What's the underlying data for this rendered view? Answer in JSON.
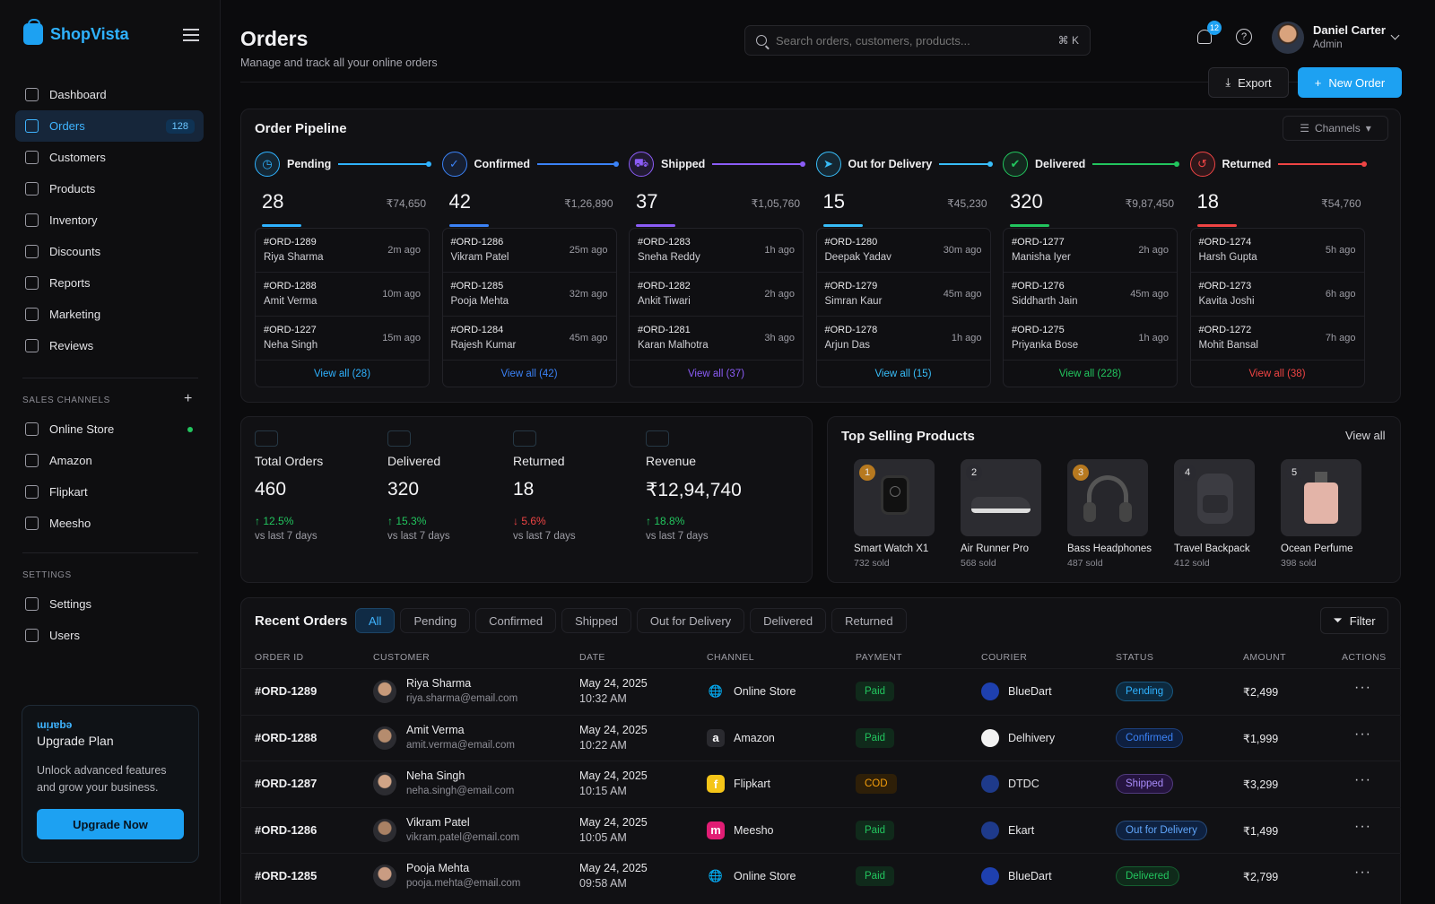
{
  "app": {
    "name": "ShopVista"
  },
  "sidebar": {
    "nav": [
      {
        "label": "Dashboard",
        "icon": "grid-icon"
      },
      {
        "label": "Orders",
        "icon": "cart-icon",
        "badge": "128",
        "active": true
      },
      {
        "label": "Customers",
        "icon": "users-icon"
      },
      {
        "label": "Products",
        "icon": "box-icon"
      },
      {
        "label": "Inventory",
        "icon": "warehouse-icon"
      },
      {
        "label": "Discounts",
        "icon": "tag-icon"
      },
      {
        "label": "Reports",
        "icon": "bar-chart-icon"
      },
      {
        "label": "Marketing",
        "icon": "megaphone-icon"
      },
      {
        "label": "Reviews",
        "icon": "star-box-icon"
      }
    ],
    "sales_channels_title": "SALES CHANNELS",
    "channels": [
      {
        "label": "Online Store",
        "icon": "globe-icon",
        "online": true
      },
      {
        "label": "Amazon",
        "icon": "amazon-icon"
      },
      {
        "label": "Flipkart",
        "icon": "flipkart-icon"
      },
      {
        "label": "Meesho",
        "icon": "meesho-icon"
      }
    ],
    "settings_title": "SETTINGS",
    "settings": [
      {
        "label": "Settings",
        "icon": "gear-icon"
      },
      {
        "label": "Users",
        "icon": "users-icon"
      }
    ],
    "upgrade": {
      "tagline": "ɯᴉɹɐbǝ",
      "title": "Upgrade Plan",
      "desc": "Unlock advanced features and grow your business.",
      "button": "Upgrade Now"
    }
  },
  "header": {
    "title": "Orders",
    "subtitle": "Manage and track all your online orders",
    "search_placeholder": "Search orders, customers, products...",
    "search_shortcut": "⌘ K",
    "notifications": "12",
    "user_name": "Daniel Carter",
    "user_role": "Admin",
    "export_label": "Export",
    "new_order_label": "New Order"
  },
  "pipeline": {
    "title": "Order Pipeline",
    "channels_label": "Channels",
    "stages": [
      {
        "name": "Pending",
        "count": "28",
        "amount": "₹74,650",
        "color": "#2fb2ff",
        "icon": "clock-icon",
        "items": [
          {
            "id": "#ORD-1289",
            "customer": "Riya Sharma",
            "time": "2m ago"
          },
          {
            "id": "#ORD-1288",
            "customer": "Amit Verma",
            "time": "10m ago"
          },
          {
            "id": "#ORD-1227",
            "customer": "Neha Singh",
            "time": "15m ago"
          }
        ],
        "view_all": "View all (28)"
      },
      {
        "name": "Confirmed",
        "count": "42",
        "amount": "₹1,26,890",
        "color": "#3b82f6",
        "icon": "check-icon",
        "items": [
          {
            "id": "#ORD-1286",
            "customer": "Vikram Patel",
            "time": "25m ago"
          },
          {
            "id": "#ORD-1285",
            "customer": "Pooja Mehta",
            "time": "32m ago"
          },
          {
            "id": "#ORD-1284",
            "customer": "Rajesh Kumar",
            "time": "45m ago"
          }
        ],
        "view_all": "View all (42)"
      },
      {
        "name": "Shipped",
        "count": "37",
        "amount": "₹1,05,760",
        "color": "#8b5cf6",
        "icon": "truck-icon",
        "items": [
          {
            "id": "#ORD-1283",
            "customer": "Sneha Reddy",
            "time": "1h ago"
          },
          {
            "id": "#ORD-1282",
            "customer": "Ankit Tiwari",
            "time": "2h ago"
          },
          {
            "id": "#ORD-1281",
            "customer": "Karan Malhotra",
            "time": "3h ago"
          }
        ],
        "view_all": "View all (37)"
      },
      {
        "name": "Out for Delivery",
        "count": "15",
        "amount": "₹45,230",
        "color": "#38bdf8",
        "icon": "send-icon",
        "items": [
          {
            "id": "#ORD-1280",
            "customer": "Deepak Yadav",
            "time": "30m ago"
          },
          {
            "id": "#ORD-1279",
            "customer": "Simran Kaur",
            "time": "45m ago"
          },
          {
            "id": "#ORD-1278",
            "customer": "Arjun Das",
            "time": "1h ago"
          }
        ],
        "view_all": "View all (15)"
      },
      {
        "name": "Delivered",
        "count": "320",
        "amount": "₹9,87,450",
        "color": "#22c55e",
        "icon": "check-circle-icon",
        "items": [
          {
            "id": "#ORD-1277",
            "customer": "Manisha Iyer",
            "time": "2h ago"
          },
          {
            "id": "#ORD-1276",
            "customer": "Siddharth Jain",
            "time": "45m ago"
          },
          {
            "id": "#ORD-1275",
            "customer": "Priyanka Bose",
            "time": "1h ago"
          }
        ],
        "view_all": "View all (228)"
      },
      {
        "name": "Returned",
        "count": "18",
        "amount": "₹54,760",
        "color": "#ef4444",
        "icon": "return-icon",
        "items": [
          {
            "id": "#ORD-1274",
            "customer": "Harsh Gupta",
            "time": "5h ago"
          },
          {
            "id": "#ORD-1273",
            "customer": "Kavita Joshi",
            "time": "6h ago"
          },
          {
            "id": "#ORD-1272",
            "customer": "Mohit Bansal",
            "time": "7h ago"
          }
        ],
        "view_all": "View all (38)"
      }
    ]
  },
  "kpis": [
    {
      "label": "Total Orders",
      "value": "460",
      "change": "12.5%",
      "trend": "up",
      "sub": "vs last 7 days"
    },
    {
      "label": "Delivered",
      "value": "320",
      "change": "15.3%",
      "trend": "up",
      "sub": "vs last 7 days"
    },
    {
      "label": "Returned",
      "value": "18",
      "change": "5.6%",
      "trend": "down",
      "sub": "vs last 7 days"
    },
    {
      "label": "Revenue",
      "value": "₹12,94,740",
      "change": "18.8%",
      "trend": "up",
      "sub": "vs last 7 days"
    }
  ],
  "top_selling": {
    "title": "Top Selling Products",
    "view_all": "View all",
    "products": [
      {
        "rank": "1",
        "name": "Smart Watch X1",
        "sold": "732 sold",
        "icon": "watch-icon"
      },
      {
        "rank": "2",
        "name": "Air Runner Pro",
        "sold": "568 sold",
        "icon": "shoe-icon"
      },
      {
        "rank": "3",
        "name": "Bass Headphones",
        "sold": "487 sold",
        "icon": "headphones-icon"
      },
      {
        "rank": "4",
        "name": "Travel Backpack",
        "sold": "412 sold",
        "icon": "backpack-icon"
      },
      {
        "rank": "5",
        "name": "Ocean Perfume",
        "sold": "398 sold",
        "icon": "perfume-icon"
      }
    ]
  },
  "recent_orders": {
    "title": "Recent Orders",
    "tabs": [
      "All",
      "Pending",
      "Confirmed",
      "Shipped",
      "Out for Delivery",
      "Delivered",
      "Returned"
    ],
    "filter_label": "Filter",
    "columns": [
      "ORDER ID",
      "CUSTOMER",
      "DATE",
      "CHANNEL",
      "PAYMENT",
      "COURIER",
      "STATUS",
      "AMOUNT",
      "ACTIONS"
    ],
    "rows": [
      {
        "id": "#ORD-1289",
        "name": "Riya Sharma",
        "email": "riya.sharma@email.com",
        "date": "May 24, 2025",
        "time": "10:32 AM",
        "channel": "Online Store",
        "payment": "Paid",
        "courier": "BlueDart",
        "status": "Pending",
        "amount": "₹2,499"
      },
      {
        "id": "#ORD-1288",
        "name": "Amit Verma",
        "email": "amit.verma@email.com",
        "date": "May 24, 2025",
        "time": "10:22 AM",
        "channel": "Amazon",
        "payment": "Paid",
        "courier": "Delhivery",
        "status": "Confirmed",
        "amount": "₹1,999"
      },
      {
        "id": "#ORD-1287",
        "name": "Neha Singh",
        "email": "neha.singh@email.com",
        "date": "May 24, 2025",
        "time": "10:15 AM",
        "channel": "Flipkart",
        "payment": "COD",
        "courier": "DTDC",
        "status": "Shipped",
        "amount": "₹3,299"
      },
      {
        "id": "#ORD-1286",
        "name": "Vikram Patel",
        "email": "vikram.patel@email.com",
        "date": "May 24, 2025",
        "time": "10:05 AM",
        "channel": "Meesho",
        "payment": "Paid",
        "courier": "Ekart",
        "status": "Out for Delivery",
        "amount": "₹1,499"
      },
      {
        "id": "#ORD-1285",
        "name": "Pooja Mehta",
        "email": "pooja.mehta@email.com",
        "date": "May 24, 2025",
        "time": "09:58 AM",
        "channel": "Online Store",
        "payment": "Paid",
        "courier": "BlueDart",
        "status": "Delivered",
        "amount": "₹2,799"
      }
    ]
  }
}
